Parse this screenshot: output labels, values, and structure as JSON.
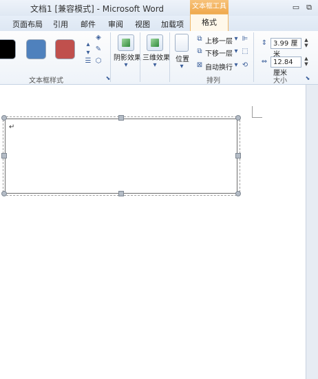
{
  "window": {
    "title": "文档1 [兼容模式] - Microsoft Word",
    "contextual_tab_group": "文本框工具",
    "minimize_icon": "minimize-icon",
    "restore_icon": "restore-icon"
  },
  "tabs": [
    "页面布局",
    "引用",
    "邮件",
    "审阅",
    "视图",
    "加载项"
  ],
  "active_tab": "格式",
  "ribbon": {
    "text_box_styles": {
      "label": "文本框样式",
      "swatch_colors": [
        "#000000",
        "#4f81bd",
        "#c0504d"
      ]
    },
    "shadow_effects": "阴影效果",
    "three_d_effects": "三维效果",
    "arrange": {
      "label": "排列",
      "position": "位置",
      "bring_forward": "上移一层",
      "send_backward": "下移一层",
      "wrap_text": "自动换行"
    },
    "size": {
      "label": "大小",
      "height": "3.99 厘米",
      "width": "12.84 厘米"
    }
  }
}
